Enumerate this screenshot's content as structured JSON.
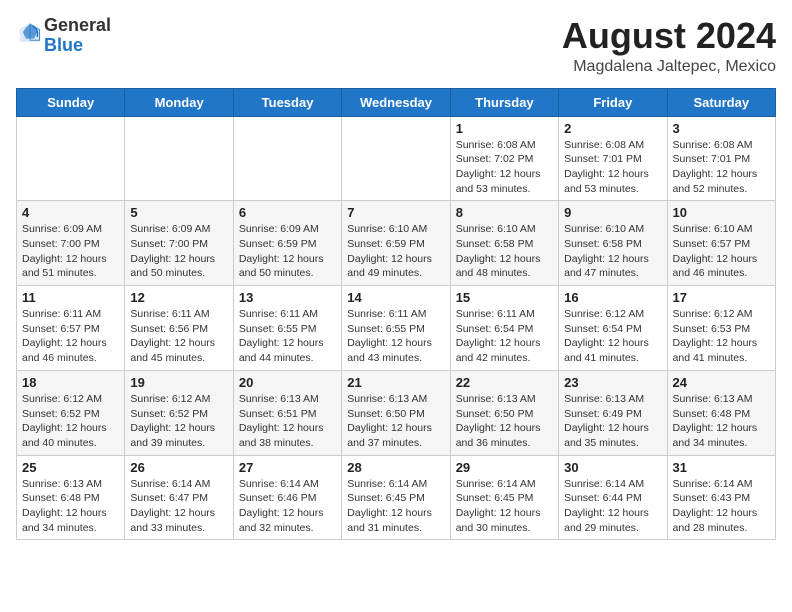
{
  "header": {
    "logo_general": "General",
    "logo_blue": "Blue",
    "month_year": "August 2024",
    "location": "Magdalena Jaltepec, Mexico"
  },
  "days_of_week": [
    "Sunday",
    "Monday",
    "Tuesday",
    "Wednesday",
    "Thursday",
    "Friday",
    "Saturday"
  ],
  "weeks": [
    [
      {
        "day": "",
        "info": ""
      },
      {
        "day": "",
        "info": ""
      },
      {
        "day": "",
        "info": ""
      },
      {
        "day": "",
        "info": ""
      },
      {
        "day": "1",
        "info": "Sunrise: 6:08 AM\nSunset: 7:02 PM\nDaylight: 12 hours\nand 53 minutes."
      },
      {
        "day": "2",
        "info": "Sunrise: 6:08 AM\nSunset: 7:01 PM\nDaylight: 12 hours\nand 53 minutes."
      },
      {
        "day": "3",
        "info": "Sunrise: 6:08 AM\nSunset: 7:01 PM\nDaylight: 12 hours\nand 52 minutes."
      }
    ],
    [
      {
        "day": "4",
        "info": "Sunrise: 6:09 AM\nSunset: 7:00 PM\nDaylight: 12 hours\nand 51 minutes."
      },
      {
        "day": "5",
        "info": "Sunrise: 6:09 AM\nSunset: 7:00 PM\nDaylight: 12 hours\nand 50 minutes."
      },
      {
        "day": "6",
        "info": "Sunrise: 6:09 AM\nSunset: 6:59 PM\nDaylight: 12 hours\nand 50 minutes."
      },
      {
        "day": "7",
        "info": "Sunrise: 6:10 AM\nSunset: 6:59 PM\nDaylight: 12 hours\nand 49 minutes."
      },
      {
        "day": "8",
        "info": "Sunrise: 6:10 AM\nSunset: 6:58 PM\nDaylight: 12 hours\nand 48 minutes."
      },
      {
        "day": "9",
        "info": "Sunrise: 6:10 AM\nSunset: 6:58 PM\nDaylight: 12 hours\nand 47 minutes."
      },
      {
        "day": "10",
        "info": "Sunrise: 6:10 AM\nSunset: 6:57 PM\nDaylight: 12 hours\nand 46 minutes."
      }
    ],
    [
      {
        "day": "11",
        "info": "Sunrise: 6:11 AM\nSunset: 6:57 PM\nDaylight: 12 hours\nand 46 minutes."
      },
      {
        "day": "12",
        "info": "Sunrise: 6:11 AM\nSunset: 6:56 PM\nDaylight: 12 hours\nand 45 minutes."
      },
      {
        "day": "13",
        "info": "Sunrise: 6:11 AM\nSunset: 6:55 PM\nDaylight: 12 hours\nand 44 minutes."
      },
      {
        "day": "14",
        "info": "Sunrise: 6:11 AM\nSunset: 6:55 PM\nDaylight: 12 hours\nand 43 minutes."
      },
      {
        "day": "15",
        "info": "Sunrise: 6:11 AM\nSunset: 6:54 PM\nDaylight: 12 hours\nand 42 minutes."
      },
      {
        "day": "16",
        "info": "Sunrise: 6:12 AM\nSunset: 6:54 PM\nDaylight: 12 hours\nand 41 minutes."
      },
      {
        "day": "17",
        "info": "Sunrise: 6:12 AM\nSunset: 6:53 PM\nDaylight: 12 hours\nand 41 minutes."
      }
    ],
    [
      {
        "day": "18",
        "info": "Sunrise: 6:12 AM\nSunset: 6:52 PM\nDaylight: 12 hours\nand 40 minutes."
      },
      {
        "day": "19",
        "info": "Sunrise: 6:12 AM\nSunset: 6:52 PM\nDaylight: 12 hours\nand 39 minutes."
      },
      {
        "day": "20",
        "info": "Sunrise: 6:13 AM\nSunset: 6:51 PM\nDaylight: 12 hours\nand 38 minutes."
      },
      {
        "day": "21",
        "info": "Sunrise: 6:13 AM\nSunset: 6:50 PM\nDaylight: 12 hours\nand 37 minutes."
      },
      {
        "day": "22",
        "info": "Sunrise: 6:13 AM\nSunset: 6:50 PM\nDaylight: 12 hours\nand 36 minutes."
      },
      {
        "day": "23",
        "info": "Sunrise: 6:13 AM\nSunset: 6:49 PM\nDaylight: 12 hours\nand 35 minutes."
      },
      {
        "day": "24",
        "info": "Sunrise: 6:13 AM\nSunset: 6:48 PM\nDaylight: 12 hours\nand 34 minutes."
      }
    ],
    [
      {
        "day": "25",
        "info": "Sunrise: 6:13 AM\nSunset: 6:48 PM\nDaylight: 12 hours\nand 34 minutes."
      },
      {
        "day": "26",
        "info": "Sunrise: 6:14 AM\nSunset: 6:47 PM\nDaylight: 12 hours\nand 33 minutes."
      },
      {
        "day": "27",
        "info": "Sunrise: 6:14 AM\nSunset: 6:46 PM\nDaylight: 12 hours\nand 32 minutes."
      },
      {
        "day": "28",
        "info": "Sunrise: 6:14 AM\nSunset: 6:45 PM\nDaylight: 12 hours\nand 31 minutes."
      },
      {
        "day": "29",
        "info": "Sunrise: 6:14 AM\nSunset: 6:45 PM\nDaylight: 12 hours\nand 30 minutes."
      },
      {
        "day": "30",
        "info": "Sunrise: 6:14 AM\nSunset: 6:44 PM\nDaylight: 12 hours\nand 29 minutes."
      },
      {
        "day": "31",
        "info": "Sunrise: 6:14 AM\nSunset: 6:43 PM\nDaylight: 12 hours\nand 28 minutes."
      }
    ]
  ]
}
